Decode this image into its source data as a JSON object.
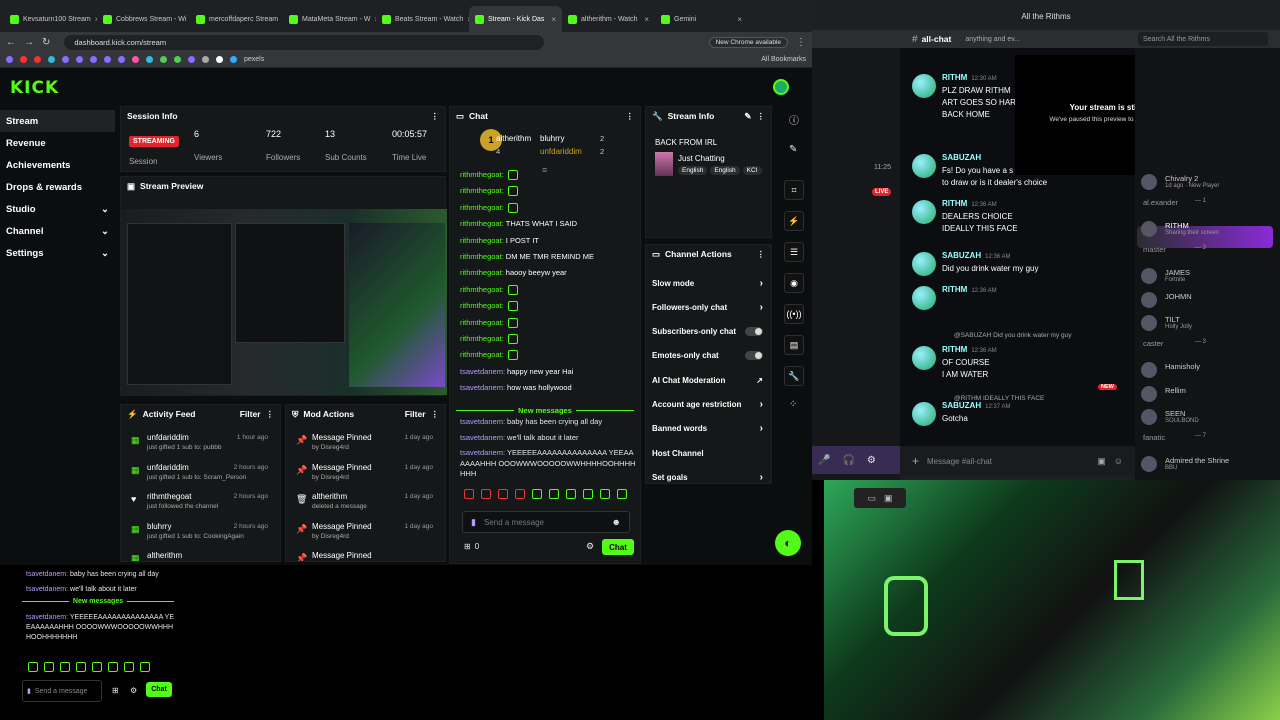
{
  "browser": {
    "tabs": [
      "Kevsaturn100 Stream",
      "Cobbrews Stream - Wi",
      "mercoffdaperc Stream",
      "MataMeta Stream - W",
      "Beats Stream - Watch",
      "Stream - Kick Das",
      "altherithm - Watch",
      "Gemini"
    ],
    "active_tab_index": 5,
    "url": "dashboard.kick.com/stream",
    "new_chrome": "New Chrome available",
    "all_bookmarks": "All Bookmarks",
    "bookmark_label": "pexels"
  },
  "kick": {
    "logo": "KICK",
    "nav": [
      "Stream",
      "Revenue",
      "Achievements",
      "Drops & rewards",
      "Studio",
      "Channel",
      "Settings"
    ],
    "session": {
      "title": "Session Info",
      "badge": "STREAMING",
      "session_label": "Session",
      "stats": [
        {
          "value": "6",
          "label": "Viewers"
        },
        {
          "value": "722",
          "label": "Followers"
        },
        {
          "value": "13",
          "label": "Sub Counts"
        },
        {
          "value": "00:05:57",
          "label": "Time Live"
        }
      ]
    },
    "preview_title": "Stream Preview",
    "activity": {
      "title": "Activity Feed",
      "filter": "Filter",
      "rows": [
        {
          "name": "unfdariddim",
          "sub": "just gifted 1 sub to: pubbb",
          "time": "1 hour ago",
          "icon": "gift"
        },
        {
          "name": "unfdariddim",
          "sub": "just gifted 1 sub to: Scram_Person",
          "time": "2 hours ago",
          "icon": "gift"
        },
        {
          "name": "rithmthegoat",
          "sub": "just followed the channel",
          "time": "2 hours ago",
          "icon": "heart"
        },
        {
          "name": "bluhrry",
          "sub": "just gifted 1 sub to: CookingAgain",
          "time": "2 hours ago",
          "icon": "gift"
        },
        {
          "name": "altherithm",
          "sub": "",
          "time": "",
          "icon": "gift"
        }
      ]
    },
    "mod": {
      "title": "Mod Actions",
      "filter": "Filter",
      "rows": [
        {
          "name": "Message Pinned",
          "sub": "by Disreg4rd",
          "time": "1 day ago",
          "icon": "pin"
        },
        {
          "name": "Message Pinned",
          "sub": "by Disreg4rd",
          "time": "1 day ago",
          "icon": "pin"
        },
        {
          "name": "altherithm",
          "sub": "deleted a message",
          "time": "1 day ago",
          "icon": "trash"
        },
        {
          "name": "Message Pinned",
          "sub": "by Disreg4rd",
          "time": "1 day ago",
          "icon": "pin"
        },
        {
          "name": "Message Pinned",
          "sub": "",
          "time": "",
          "icon": "pin"
        }
      ]
    },
    "chat": {
      "title": "Chat",
      "top_gifters": [
        {
          "name": "altherithm",
          "count": "4"
        },
        {
          "name": "bluhrry",
          "count": "2"
        },
        {
          "name": "unfdariddim",
          "count": "2"
        }
      ],
      "messages": [
        {
          "user": "rithmthegoat:",
          "text": "",
          "emote": true
        },
        {
          "user": "rithmthegoat:",
          "text": "",
          "emote": true
        },
        {
          "user": "rithmthegoat:",
          "text": "",
          "emote": true
        },
        {
          "user": "rithmthegoat:",
          "text": "THATS WHAT I SAID",
          "emote": false
        },
        {
          "user": "rithmthegoat:",
          "text": "I POST IT",
          "emote": false
        },
        {
          "user": "rithmthegoat:",
          "text": "DM ME TMR REMIND ME",
          "emote": false
        },
        {
          "user": "rithmthegoat:",
          "text": "haooy beeyw year",
          "emote": false
        },
        {
          "user": "rithmthegoat:",
          "text": "",
          "emote": true
        },
        {
          "user": "rithmthegoat:",
          "text": "",
          "emote": true
        },
        {
          "user": "rithmthegoat:",
          "text": "",
          "emote": true
        },
        {
          "user": "rithmthegoat:",
          "text": "",
          "emote": true
        },
        {
          "user": "rithmthegoat:",
          "text": "",
          "emote": true
        },
        {
          "user": "tsavetdanem:",
          "text": "happy new year Hai",
          "emote": false
        },
        {
          "user": "tsavetdanem:",
          "text": "how was hollywood",
          "emote": false
        }
      ],
      "new_messages": "New messages",
      "after": [
        {
          "user": "tsavetdanem:",
          "text": "baby has been crying all day"
        },
        {
          "user": "tsavetdanem:",
          "text": "we'll talk about it later"
        },
        {
          "user": "tsavetdanem:",
          "text": "YEEEEEAAAAAAAAAAAAAA YEEAAAAAAHHH OOOWWWOOOOOWWHHHHOOHHHHHHH"
        }
      ],
      "placeholder": "Send a message",
      "count": "0",
      "send": "Chat"
    },
    "stream_info": {
      "title": "Stream Info",
      "stream_title": "BACK FROM IRL",
      "category": "Just Chatting",
      "tags": [
        "English",
        "English",
        "KCI"
      ]
    },
    "channel_actions": {
      "title": "Channel Actions",
      "items": [
        {
          "label": "Slow mode",
          "control": "chevron"
        },
        {
          "label": "Followers-only chat",
          "control": "chevron"
        },
        {
          "label": "Subscribers-only chat",
          "control": "toggle"
        },
        {
          "label": "Emotes-only chat",
          "control": "toggle"
        },
        {
          "label": "AI Chat Moderation",
          "control": "external"
        },
        {
          "label": "Account age restriction",
          "control": "chevron"
        },
        {
          "label": "Banned words",
          "control": "chevron"
        },
        {
          "label": "Host Channel",
          "control": "none"
        },
        {
          "label": "Set goals",
          "control": "chevron"
        }
      ]
    }
  },
  "discord": {
    "window_title": "All the Rithms",
    "channel": "all-chat",
    "channel_topic": "anything and ev...",
    "search": "Search All the Rithms",
    "notice_title": "Your stream is still running!",
    "notice_body": "We've paused this preview to save your resources.",
    "messages": [
      {
        "name": "RITHM",
        "time": "12:30 AM",
        "lines": [
          "PLZ DRAW RITHM",
          "ART GOES SO HAR",
          "BACK HOME"
        ]
      },
      {
        "name": "SABUZAH",
        "time": "",
        "lines": [
          "Fs! Do you have a s",
          "to draw or is it dealer's choice"
        ]
      },
      {
        "name": "RITHM",
        "time": "12:36 AM",
        "lines": [
          "DEALERS CHOICE",
          "IDEALLY THIS FACE"
        ]
      },
      {
        "name": "SABUZAH",
        "time": "12:36 AM",
        "lines": [
          "Did you drink water my guy"
        ]
      },
      {
        "name": "RITHM",
        "time": "12:36 AM",
        "lines": [
          ""
        ]
      },
      {
        "name": "RITHM",
        "time": "12:36 AM",
        "lines": [
          "OF COURSE",
          "I AM WATER"
        ]
      },
      {
        "name": "SABUZAH",
        "time": "12:37 AM",
        "lines": [
          "Gotcha"
        ]
      }
    ],
    "reply1": "@SABUZAH Did you drink water my guy",
    "reply2": "@RITHM IDEALLY THIS FACE",
    "input_placeholder": "Message #all-chat",
    "live": "LIVE",
    "new": "NEW",
    "time_side": "11:25",
    "members": [
      {
        "name": "Chivalry 2",
        "sub": "1d ago · New Player"
      },
      {
        "name": "al.exander",
        "sub": "— 1"
      },
      {
        "name": "RITHM",
        "sub": "Sharing their screen"
      },
      {
        "name": "master",
        "sub": "— 3"
      },
      {
        "name": "JAMES",
        "sub": "Fortnite"
      },
      {
        "name": "JOHMN",
        "sub": ""
      },
      {
        "name": "TILT",
        "sub": "Holly Jolly"
      },
      {
        "name": "caster",
        "sub": "— 3"
      },
      {
        "name": "Hamisholy",
        "sub": ""
      },
      {
        "name": "Rellim",
        "sub": ""
      },
      {
        "name": "SEEN",
        "sub": "SOULBOND"
      },
      {
        "name": "fanatic",
        "sub": "— 7"
      },
      {
        "name": "Admired the Shrine",
        "sub": "BBU"
      }
    ]
  },
  "mini_chat": {
    "lines": [
      {
        "user": "tsavetdanem:",
        "text": "baby has been crying all day"
      },
      {
        "user": "tsavetdanem:",
        "text": "we'll talk about it later"
      }
    ],
    "new_messages": "New messages",
    "last_user": "tsavetdanem:",
    "last_text": "YEEEEEAAAAAAAAAAAAAA YEEAAAAAAHHH OOOOWWWOOOOOWWHHHHOOHHHHHHH",
    "placeholder": "Send a message",
    "send": "Chat"
  }
}
